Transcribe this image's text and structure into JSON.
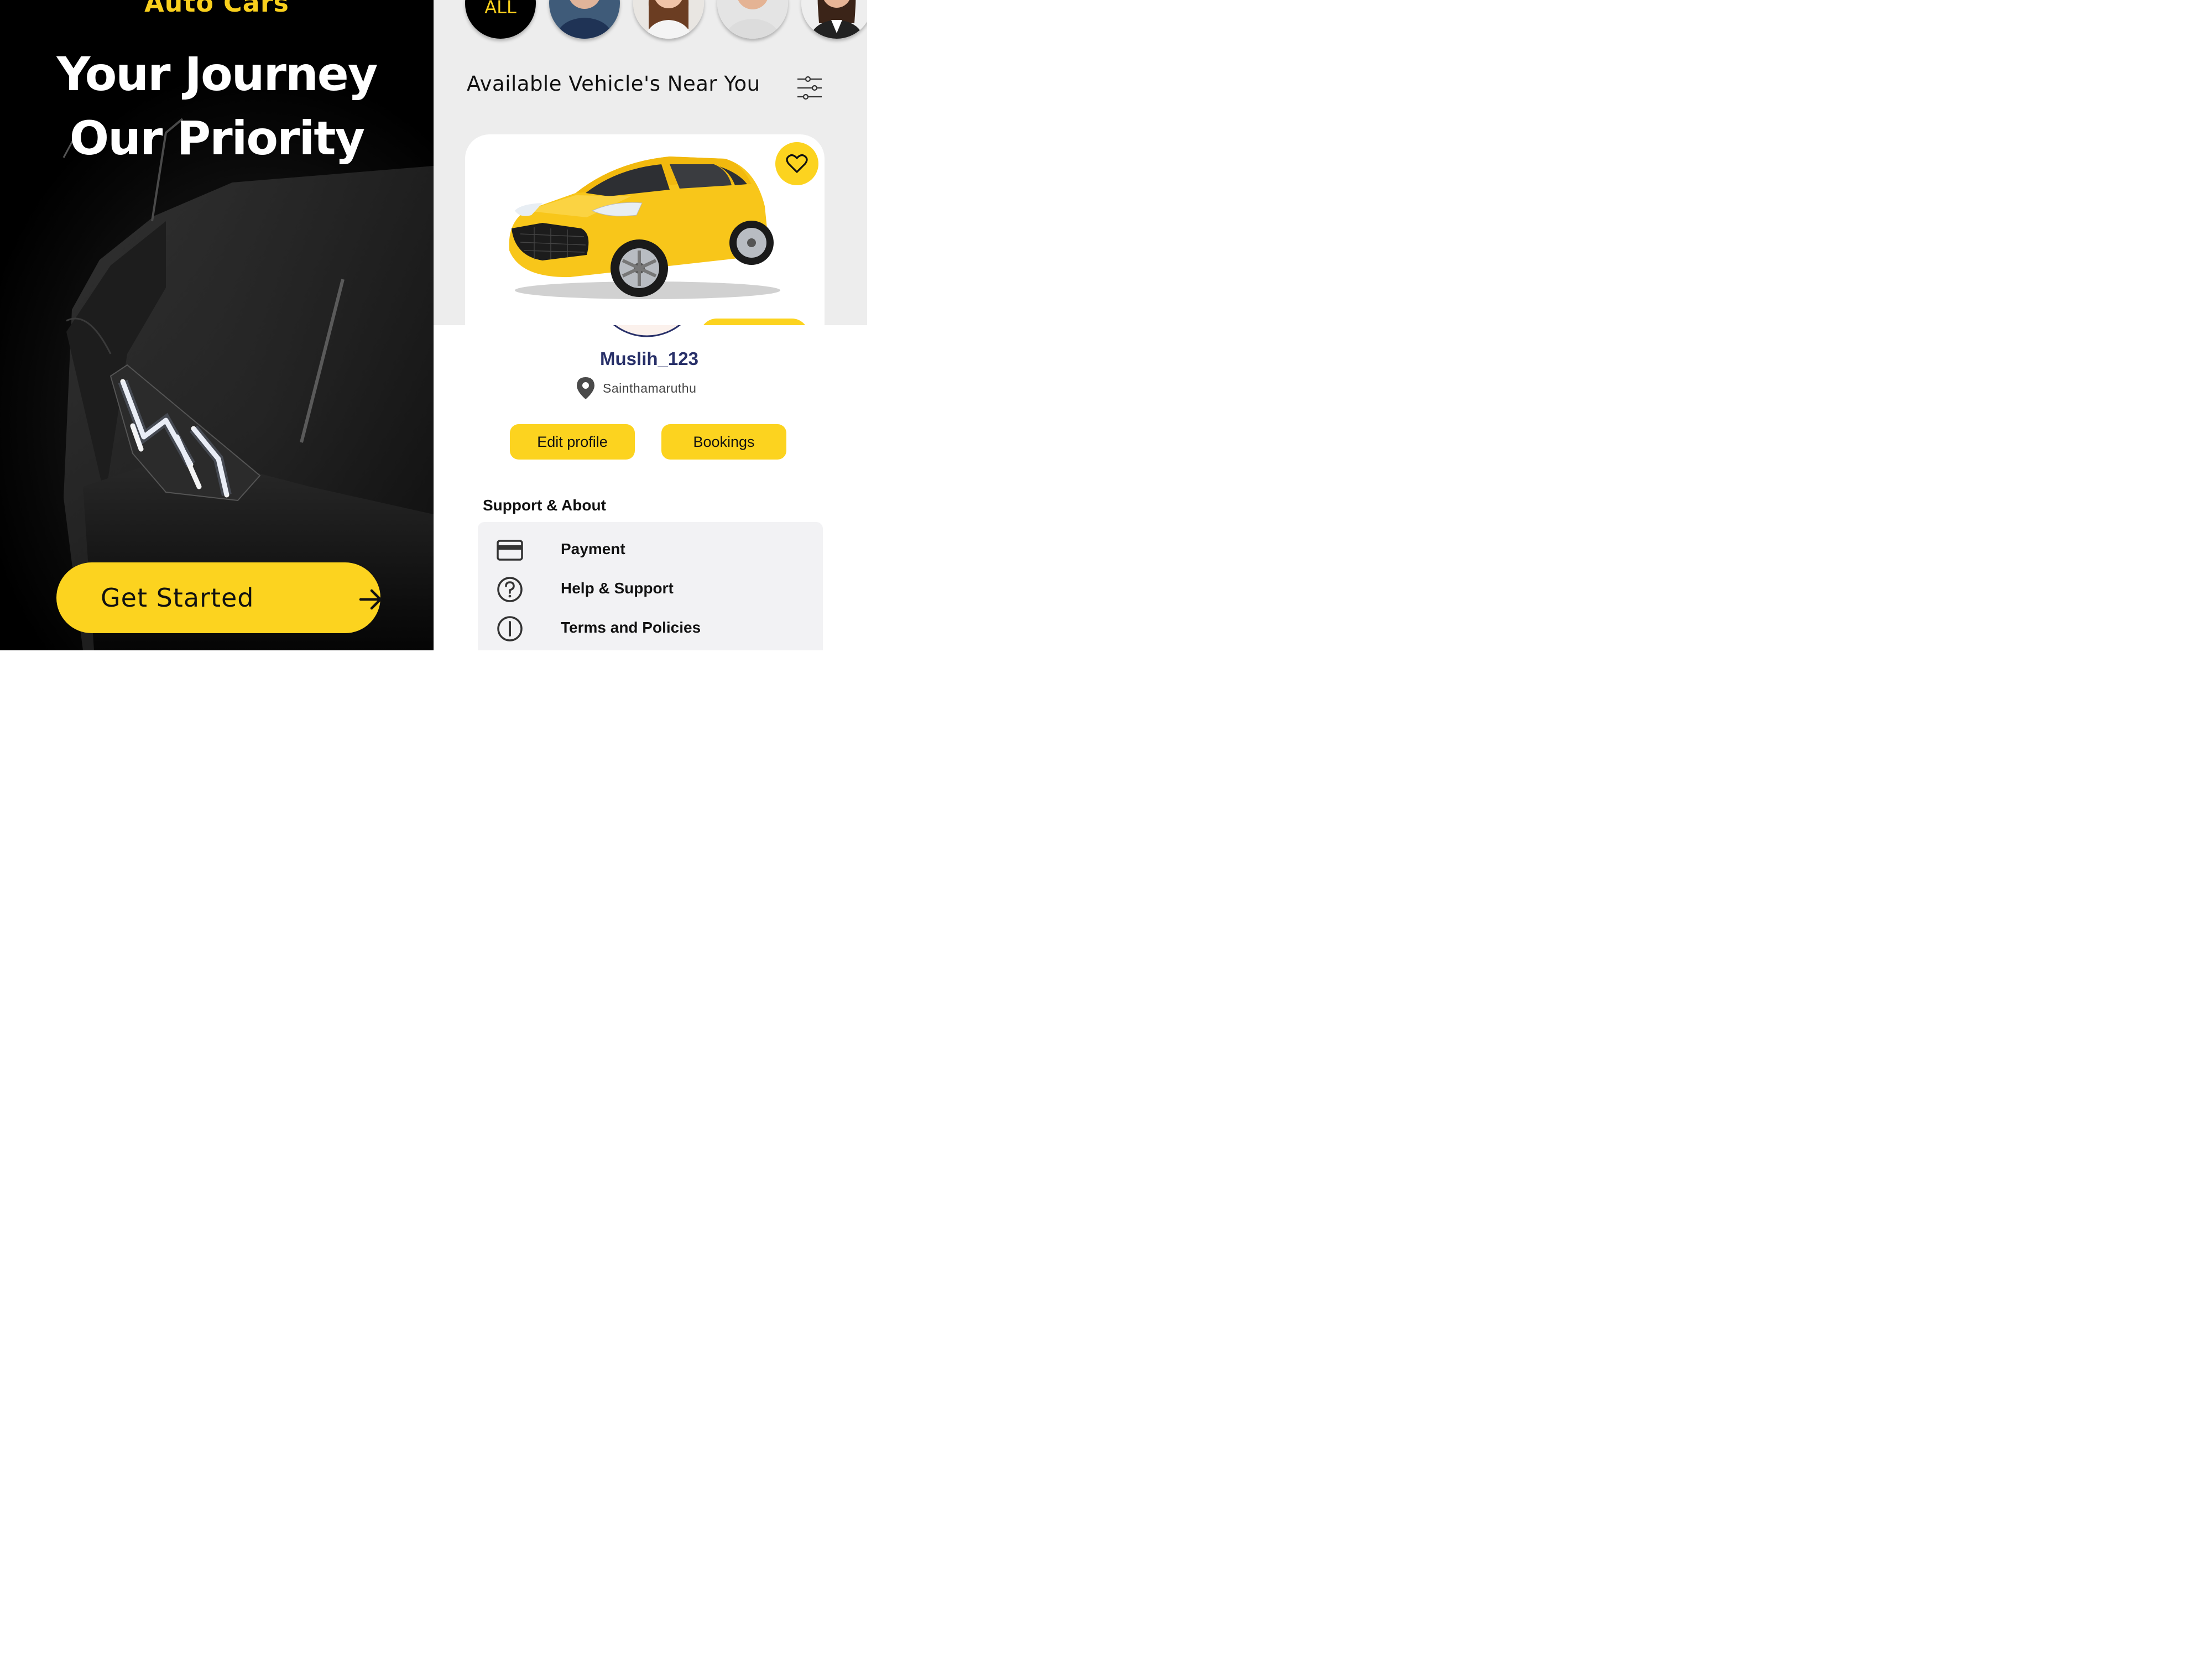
{
  "splash": {
    "brand": "Auto Cars",
    "headline_line1": "Your Journey",
    "headline_line2": "Our Priority",
    "cta_label": "Get Started",
    "accent_color": "#fcd31f"
  },
  "vehicles": {
    "categories": [
      {
        "label": "ALL",
        "type": "text"
      },
      {
        "label": "",
        "type": "avatar"
      },
      {
        "label": "",
        "type": "avatar"
      },
      {
        "label": "",
        "type": "avatar"
      },
      {
        "label": "",
        "type": "avatar"
      }
    ],
    "section_title": "Available Vehicle's Near You",
    "filter_icon": "sliders-icon",
    "card": {
      "favorite_icon": "heart-icon"
    }
  },
  "profile": {
    "username": "Muslih_123",
    "location": "Sainthamaruthu",
    "location_icon": "map-pin-icon",
    "edit_label": "Edit profile",
    "bookings_label": "Bookings",
    "support_heading": "Support & About",
    "menu": [
      {
        "label": "Payment",
        "icon": "credit-card-icon"
      },
      {
        "label": "Help & Support",
        "icon": "help-circle-icon"
      },
      {
        "label": "Terms and Policies",
        "icon": "info-circle-icon"
      }
    ]
  }
}
